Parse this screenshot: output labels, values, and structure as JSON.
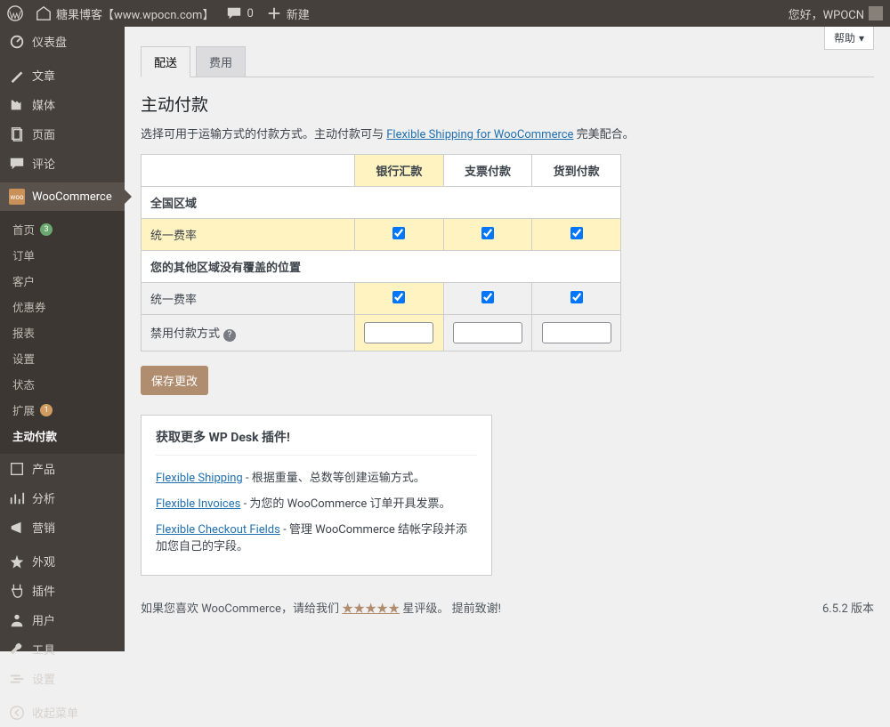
{
  "adminbar": {
    "site_title": "糖果博客【www.wpocn.com】",
    "comments_count": "0",
    "new_label": "新建",
    "greeting": "您好，WPOCN"
  },
  "help_label": "帮助",
  "sidebar": {
    "dashboard": "仪表盘",
    "posts": "文章",
    "media": "媒体",
    "pages": "页面",
    "comments": "评论",
    "woocommerce": "WooCommerce",
    "submenu": {
      "home": "首页",
      "home_badge": "3",
      "orders": "订单",
      "customers": "客户",
      "coupons": "优惠券",
      "reports": "报表",
      "settings": "设置",
      "status": "状态",
      "extensions": "扩展",
      "ext_badge": "1",
      "active_payment": "主动付款"
    },
    "products": "产品",
    "analytics": "分析",
    "marketing": "营销",
    "appearance": "外观",
    "plugins": "插件",
    "users": "用户",
    "tools": "工具",
    "wpsettings": "设置",
    "collapse": "收起菜单"
  },
  "tabs": {
    "shipping": "配送",
    "fees": "费用"
  },
  "page": {
    "heading": "主动付款",
    "desc_prefix": "选择可用于运输方式的付款方式。主动付款可与 ",
    "desc_link": "Flexible Shipping for WooCommerce",
    "desc_suffix": " 完美配合。"
  },
  "table": {
    "col_bank": "银行汇款",
    "col_cheque": "支票付款",
    "col_cod": "货到付款",
    "section1": "全国区域",
    "flatrate": "统一费率",
    "section2": "您的其他区域没有覆盖的位置",
    "disable": "禁用付款方式"
  },
  "save_button": "保存更改",
  "promo": {
    "heading": "获取更多 WP Desk 插件!",
    "p1_link": "Flexible Shipping",
    "p1_text": " - 根据重量、总数等创建运输方式。",
    "p2_link": "Flexible Invoices",
    "p2_text": " - 为您的 WooCommerce 订单开具发票。",
    "p3_link": "Flexible Checkout Fields",
    "p3_text": " - 管理 WooCommerce 结帐字段并添加您自己的字段。"
  },
  "footer": {
    "like_prefix": "如果您喜欢 WooCommerce，请给我们 ",
    "stars": "★★★★★",
    "like_suffix": " 星评级。 提前致谢!",
    "version": "6.5.2 版本"
  }
}
